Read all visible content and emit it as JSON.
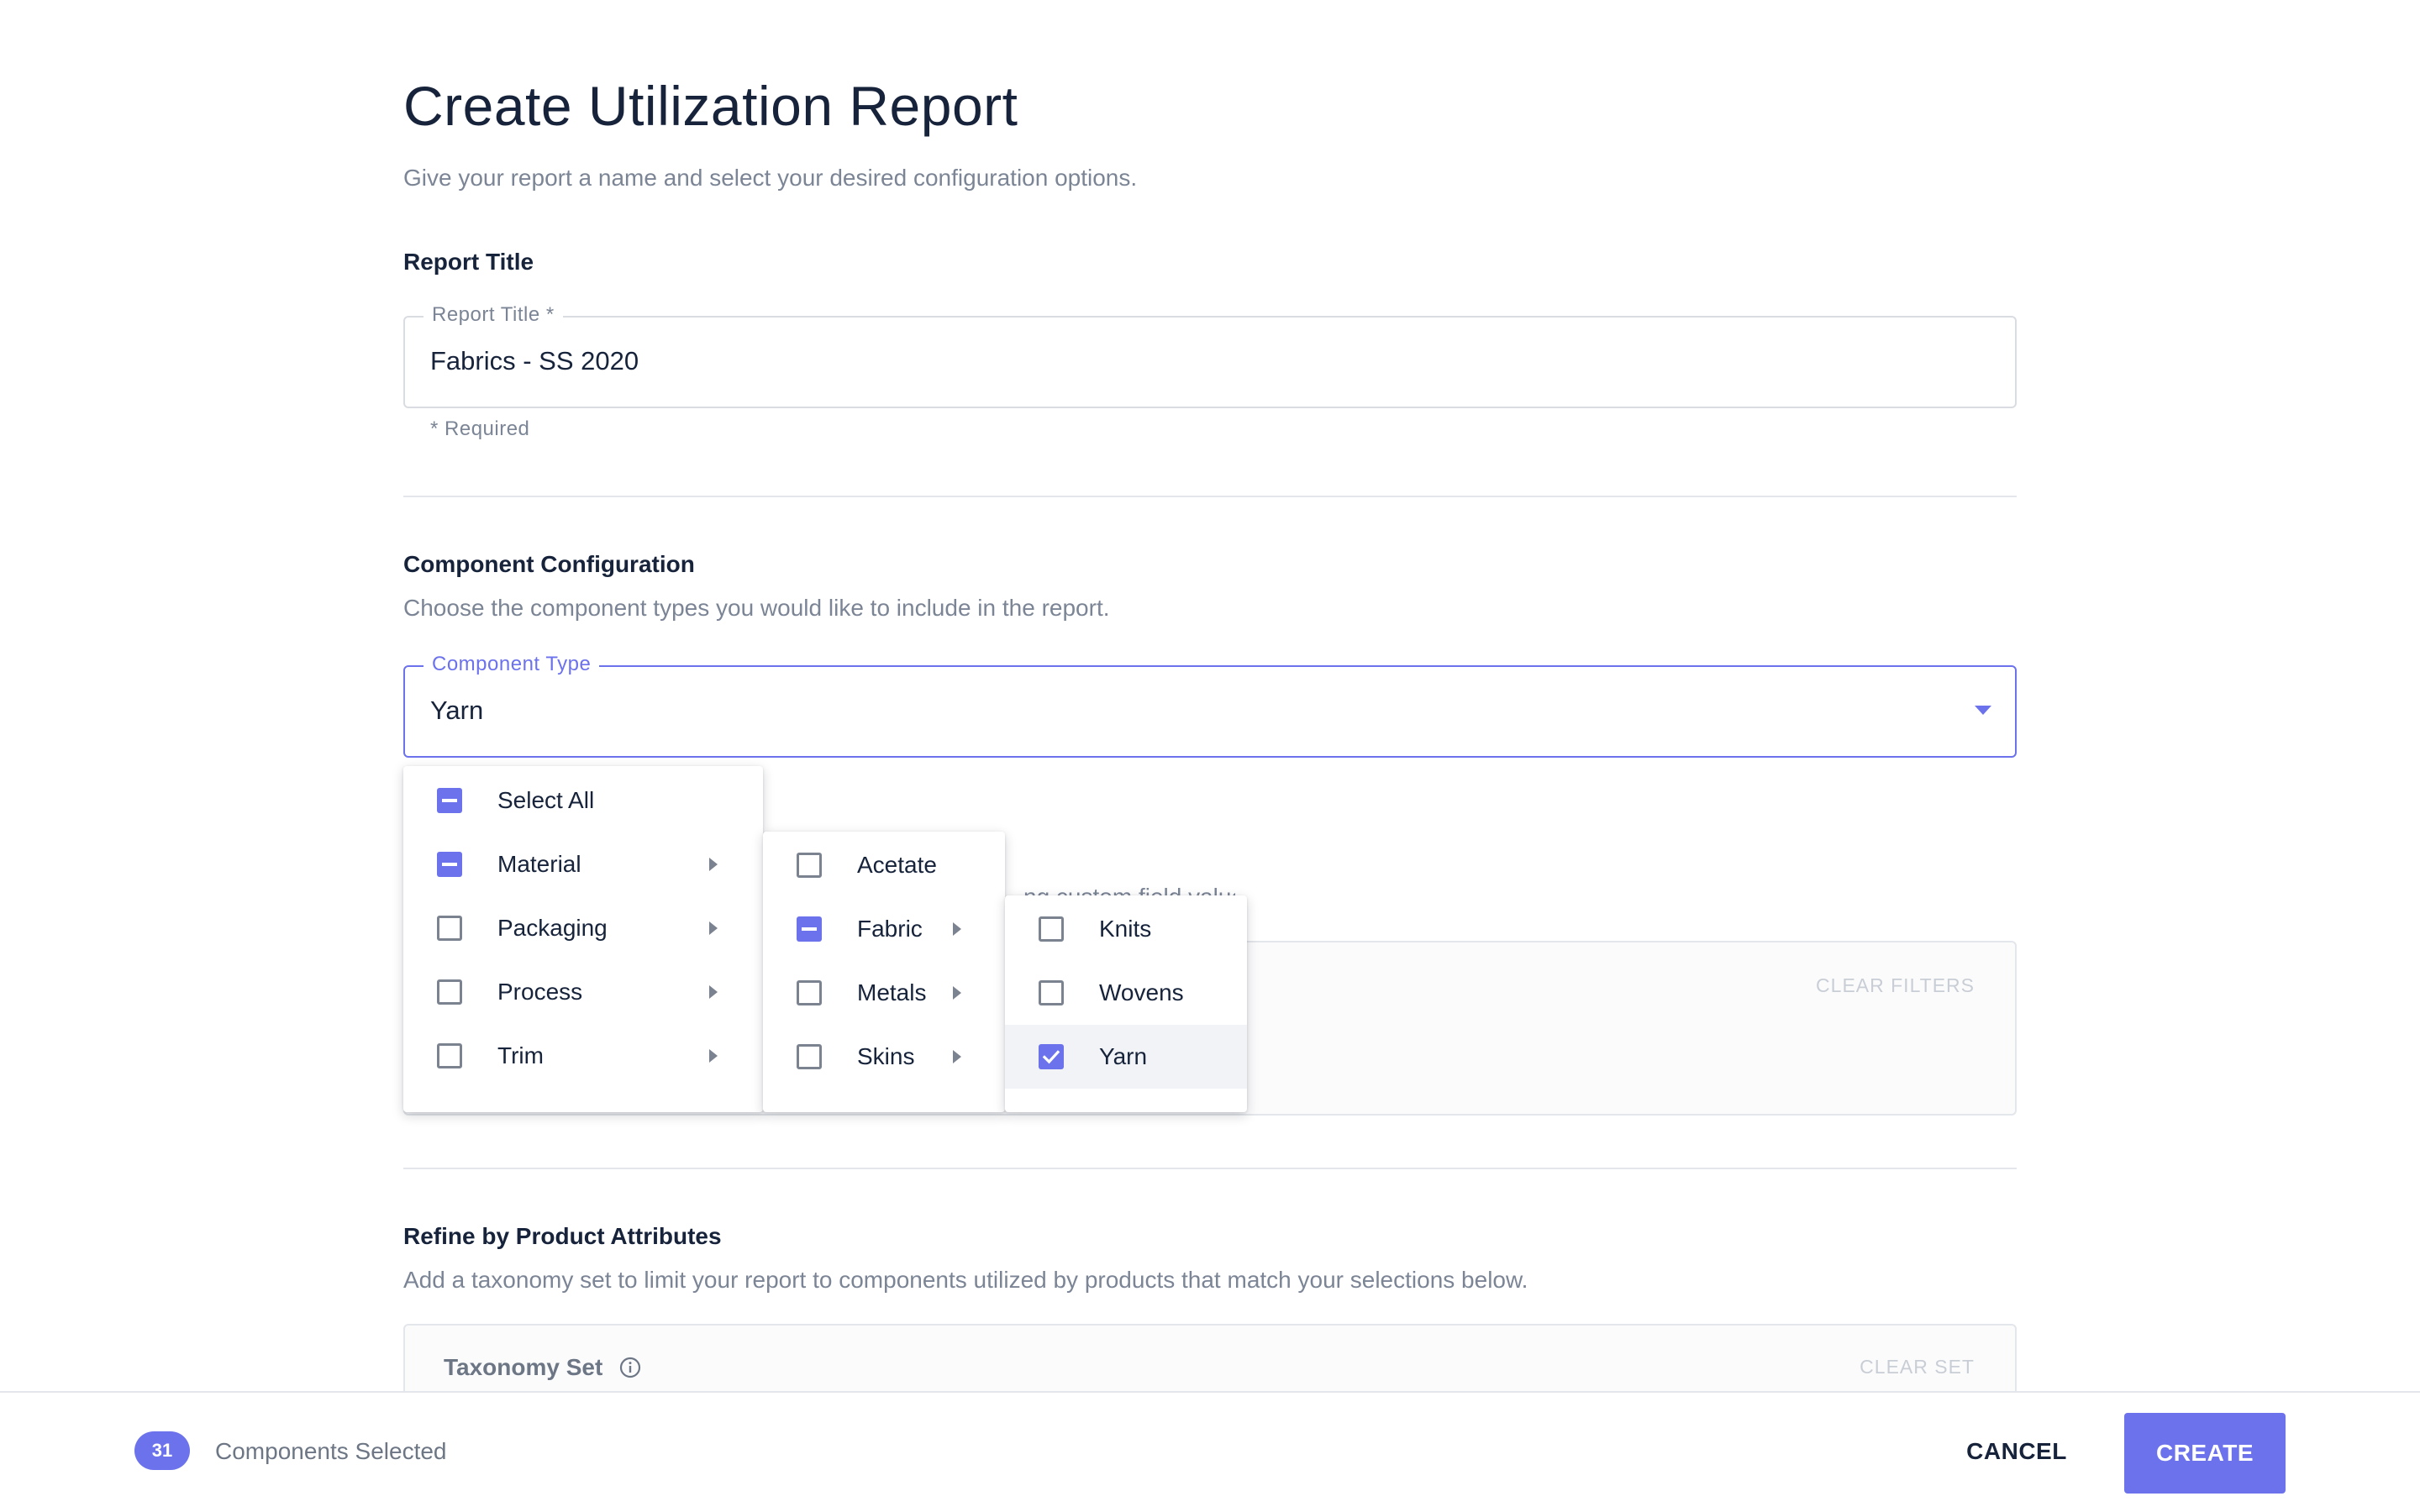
{
  "header": {
    "title": "Create Utilization Report",
    "subtitle": "Give your report a name and select your desired configuration options."
  },
  "report_title_section": {
    "heading": "Report Title",
    "field": {
      "label": "Report Title *",
      "value": "Fabrics - SS 2020",
      "helper": "* Required"
    }
  },
  "component_section": {
    "heading": "Component Configuration",
    "description": "Choose the component types you would like to include in the report.",
    "field": {
      "label": "Component Type",
      "value": "Yarn"
    },
    "obscured_text": "…ng custom field values",
    "clear_filters": "CLEAR FILTERS"
  },
  "menus": {
    "level1": [
      {
        "label": "Select All",
        "state": "indeterminate",
        "has_submenu": false
      },
      {
        "label": "Material",
        "state": "indeterminate",
        "has_submenu": true
      },
      {
        "label": "Packaging",
        "state": "unchecked",
        "has_submenu": true
      },
      {
        "label": "Process",
        "state": "unchecked",
        "has_submenu": true
      },
      {
        "label": "Trim",
        "state": "unchecked",
        "has_submenu": true
      }
    ],
    "level2": [
      {
        "label": "Acetate",
        "state": "unchecked",
        "has_submenu": false
      },
      {
        "label": "Fabric",
        "state": "indeterminate",
        "has_submenu": true
      },
      {
        "label": "Metals",
        "state": "unchecked",
        "has_submenu": true
      },
      {
        "label": "Skins",
        "state": "unchecked",
        "has_submenu": true
      }
    ],
    "level3": [
      {
        "label": "Knits",
        "state": "unchecked"
      },
      {
        "label": "Wovens",
        "state": "unchecked"
      },
      {
        "label": "Yarn",
        "state": "checked",
        "highlighted": true
      }
    ]
  },
  "product_attributes_section": {
    "heading": "Refine by Product Attributes",
    "description": "Add a taxonomy set to limit your report to components utilized by products that match your selections below.",
    "taxonomy_label": "Taxonomy Set",
    "clear_set": "CLEAR SET"
  },
  "footer": {
    "count": "31",
    "count_label": "Components Selected",
    "cancel_label": "CANCEL",
    "create_label": "CREATE"
  },
  "colors": {
    "accent": "#6c72ec",
    "text_primary": "#16233a",
    "text_secondary": "#7b8595",
    "border": "#d9dce1"
  },
  "icons": {
    "dropdown": "caret-down-icon",
    "submenu": "chevron-right-icon",
    "info": "info-icon",
    "check": "check-icon"
  }
}
